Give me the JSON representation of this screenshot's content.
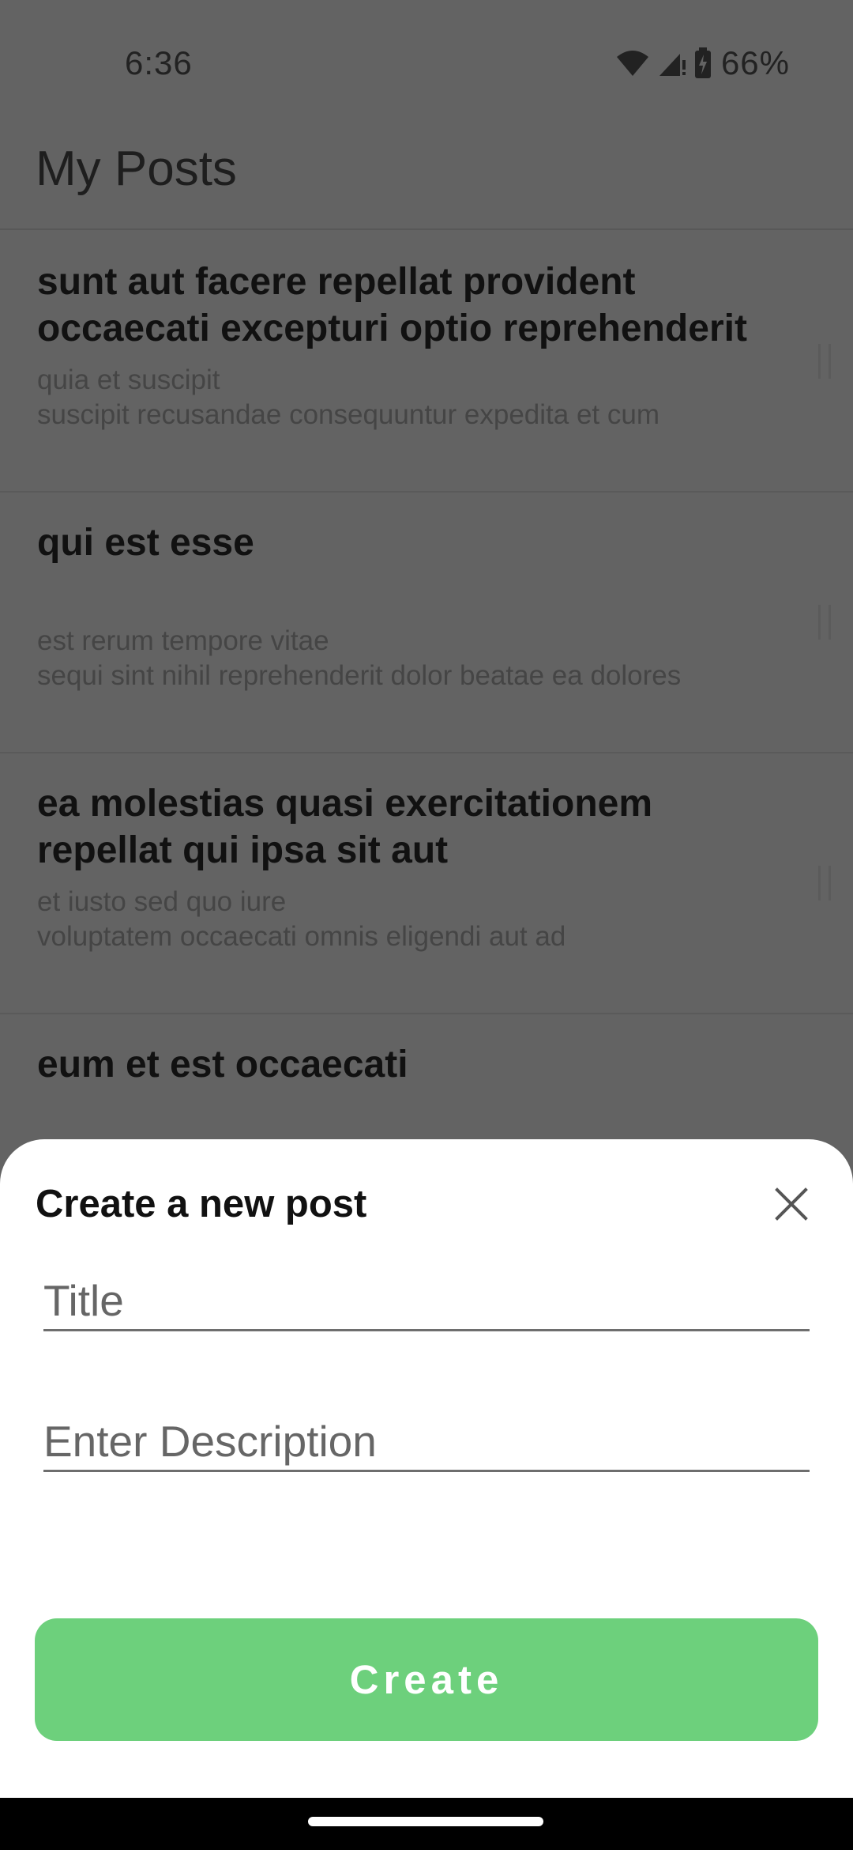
{
  "status_bar": {
    "time": "6:36",
    "battery_percent": "66%",
    "icons": [
      "wifi-icon",
      "cell-signal-icon",
      "battery-charging-icon"
    ]
  },
  "header": {
    "title": "My Posts"
  },
  "posts": [
    {
      "title": "sunt aut facere repellat provident occaecati excepturi optio reprehenderit",
      "body": "quia et suscipit\nsuscipit recusandae consequuntur expedita et cum"
    },
    {
      "title": "qui est esse",
      "body": "est rerum tempore vitae\nsequi sint nihil reprehenderit dolor beatae ea dolores"
    },
    {
      "title": "ea molestias quasi exercitationem repellat qui ipsa sit aut",
      "body": "et iusto sed quo iure\nvoluptatem occaecati omnis eligendi aut ad"
    },
    {
      "title": "eum et est occaecati",
      "body": ""
    }
  ],
  "sheet": {
    "title": "Create a new post",
    "title_placeholder": "Title",
    "title_value": "",
    "description_placeholder": "Enter Description",
    "description_value": "",
    "create_label": "Create",
    "create_color": "#6dd07c"
  }
}
